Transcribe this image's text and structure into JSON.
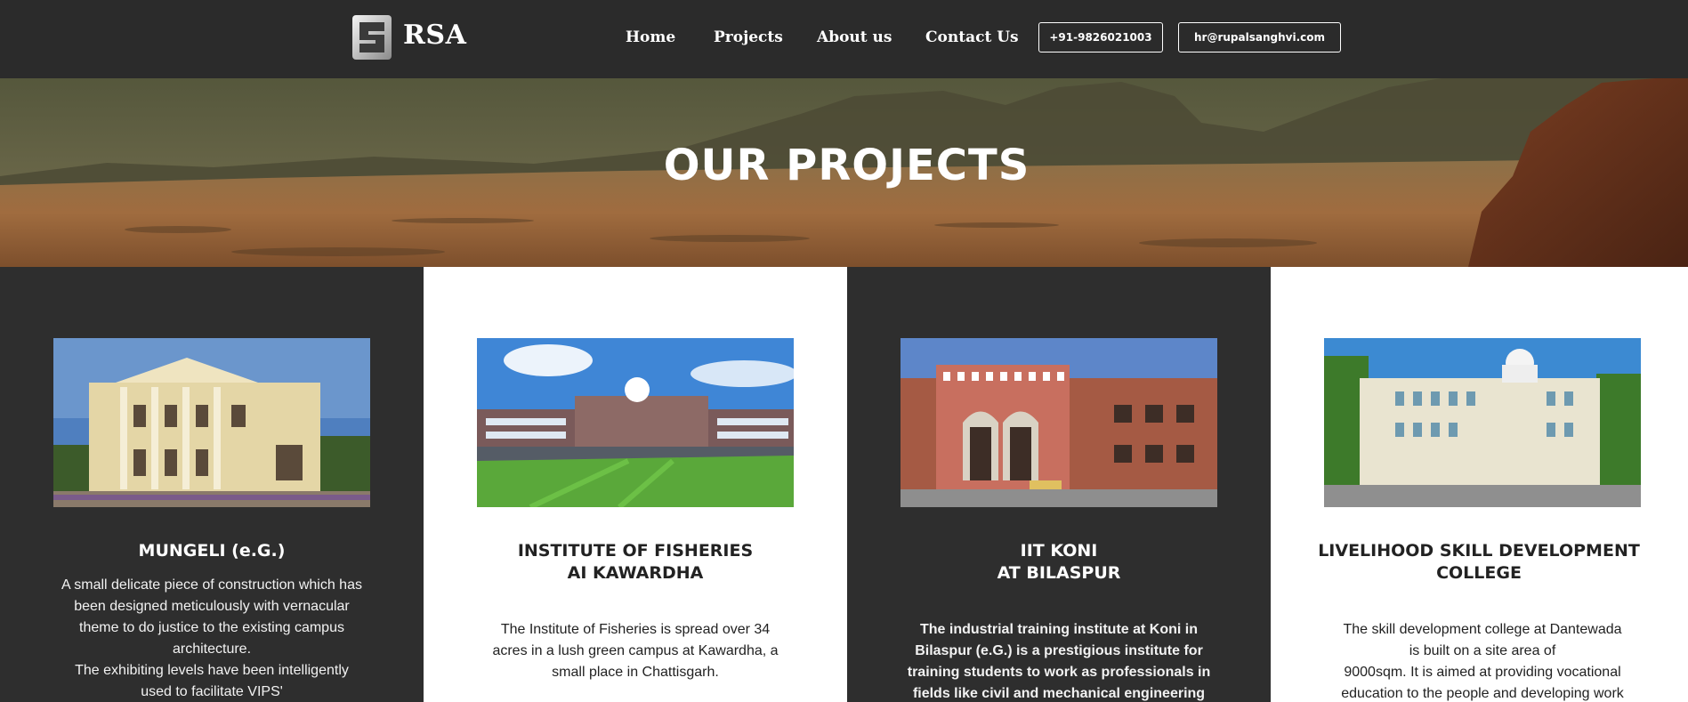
{
  "header": {
    "brand": "RSA",
    "nav": [
      "Home",
      "Projects",
      "About us",
      "Contact Us"
    ],
    "phone": "+91-9826021003",
    "email": "hr@rupalsanghvi.com"
  },
  "hero": {
    "title": "OUR PROJECTS"
  },
  "projects": [
    {
      "title_lines": [
        "MUNGELI (e.G.)"
      ],
      "desc_lines": [
        "A small delicate piece of construction which has",
        "been designed meticulously with vernacular",
        "theme to do justice to the existing campus",
        "architecture.",
        "The exhibiting levels have been intelligently",
        "used to facilitate VIPS'"
      ]
    },
    {
      "title_lines": [
        "INSTITUTE OF FISHERIES",
        "AI KAWARDHA"
      ],
      "desc_lines": [
        "The Institute of Fisheries is spread over 34",
        "acres in a lush green campus at Kawardha, a",
        "small place in Chattisgarh."
      ]
    },
    {
      "title_lines": [
        "IIT KONI",
        "AT BILASPUR"
      ],
      "desc_lines": [
        "The industrial training institute at Koni in",
        "Bilaspur (e.G.) is a prestigious institute for",
        "training students to work as professionals in",
        "fields like civil and mechanical engineering"
      ]
    },
    {
      "title_lines": [
        "LIVELIHOOD SKILL DEVELOPMENT",
        "COLLEGE"
      ],
      "desc_lines": [
        "The skill development college at Dantewada",
        "is built on a site area of",
        "9000sqm. It is aimed at providing vocational",
        "education to the people and developing work"
      ]
    }
  ],
  "colors": {
    "header_bg": "#2b2b2b",
    "dark_panel": "#2e2e2e",
    "light_panel": "#ffffff"
  },
  "icons": [
    "rsa-logo-icon"
  ]
}
